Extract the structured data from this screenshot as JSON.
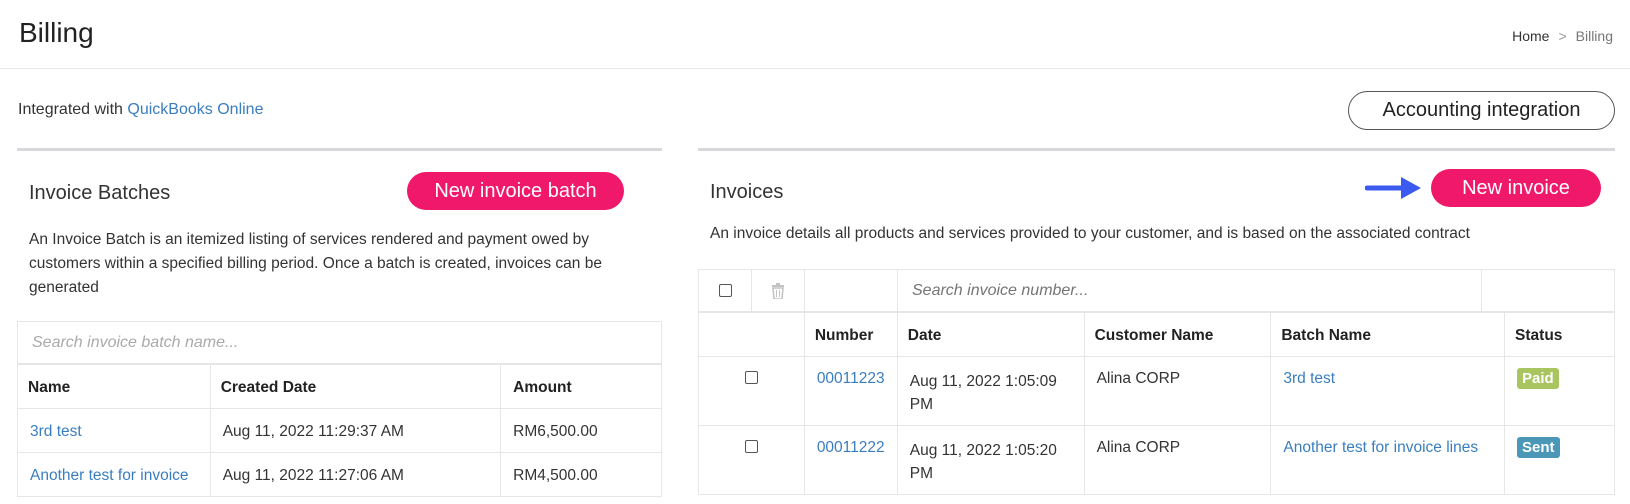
{
  "header": {
    "title": "Billing",
    "breadcrumb": {
      "home": "Home",
      "separator": ">",
      "current": "Billing"
    }
  },
  "integration": {
    "prefix": "Integrated with",
    "provider": "QuickBooks Online",
    "button_label": "Accounting integration"
  },
  "batches": {
    "title": "Invoice Batches",
    "new_button": "New invoice batch",
    "description": "An Invoice Batch is an itemized listing of services rendered and payment owed by customers within a specified billing period. Once a batch is created, invoices can be generated",
    "search_placeholder": "Search invoice batch name...",
    "columns": {
      "name": "Name",
      "created": "Created Date",
      "amount": "Amount"
    },
    "rows": [
      {
        "name": "3rd test",
        "created": "Aug 11, 2022 11:29:37 AM",
        "amount": "RM6,500.00"
      },
      {
        "name": "Another test for invoice",
        "created": "Aug 11, 2022 11:27:06 AM",
        "amount": "RM4,500.00"
      }
    ]
  },
  "invoices": {
    "title": "Invoices",
    "new_button": "New invoice",
    "description": "An invoice details all products and services provided to your customer, and is based on the associated contract",
    "search_placeholder": "Search invoice number...",
    "columns": {
      "number": "Number",
      "date": "Date",
      "customer": "Customer Name",
      "batch": "Batch Name",
      "status": "Status"
    },
    "rows": [
      {
        "number": "00011223",
        "date": "Aug 11, 2022 1:05:09 PM",
        "customer": "Alina CORP",
        "batch": "3rd test",
        "status": "Paid"
      },
      {
        "number": "00011222",
        "date": "Aug 11, 2022 1:05:20 PM",
        "customer": "Alina CORP",
        "batch": "Another test for invoice lines",
        "status": "Sent"
      }
    ]
  },
  "colors": {
    "accent_pink": "#f0186b",
    "link_blue": "#3a7ebf",
    "paid_badge": "#a8c560",
    "sent_badge": "#4a97b8",
    "arrow_blue": "#3b5bf0"
  },
  "icons": {
    "trash": "trash-icon",
    "arrow": "arrow-right-icon"
  }
}
